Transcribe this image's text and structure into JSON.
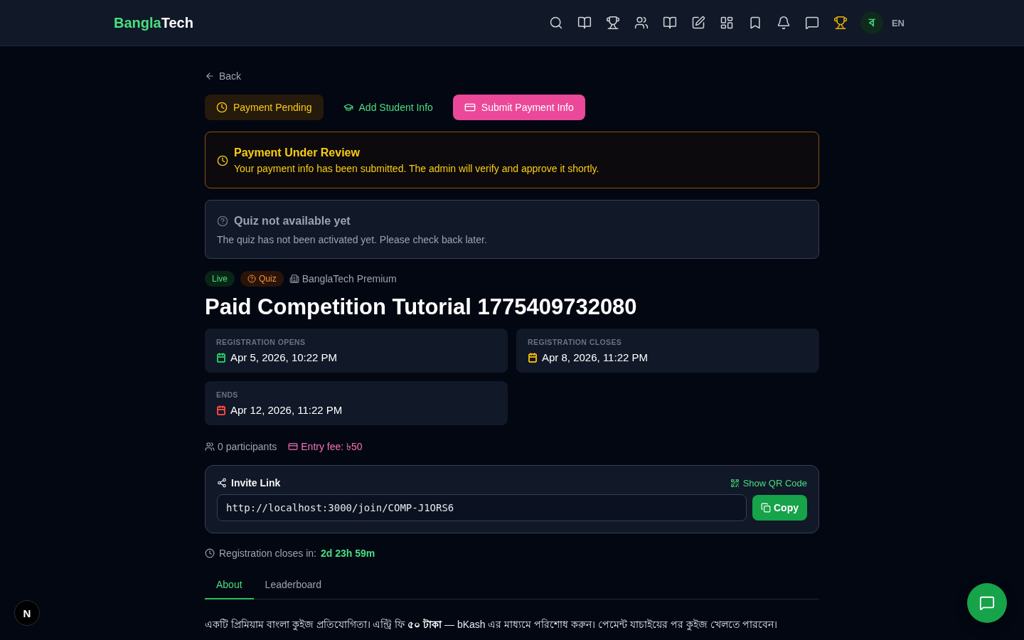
{
  "header": {
    "logo": {
      "part_1": "Bangla",
      "part_2": "Tech"
    },
    "avatar_initial": "ব",
    "language": "EN"
  },
  "back_link": "Back",
  "actions": [
    {
      "kind": "status",
      "label": "Payment Pending"
    },
    {
      "kind": "link",
      "label": "Add Student Info"
    },
    {
      "kind": "primary",
      "label": "Submit Payment Info"
    }
  ],
  "payment_alert": {
    "title": "Payment Under Review",
    "message": "Your payment info has been submitted. The admin will verify and approve it shortly."
  },
  "quiz_notice": {
    "title": "Quiz not available yet",
    "message": "The quiz has not been activated yet. Please check back later."
  },
  "badges": [
    {
      "kind": "status",
      "label": "Live"
    },
    {
      "kind": "type",
      "label": "Quiz"
    }
  ],
  "organizer": "BanglaTech Premium",
  "title": "Paid Competition Tutorial 1775409732080",
  "dates": [
    {
      "label": "REGISTRATION OPENS",
      "value": "Apr 5, 2026, 10:22 PM",
      "color": "#22c55e"
    },
    {
      "label": "REGISTRATION CLOSES",
      "value": "Apr 8, 2026, 11:22 PM",
      "color": "#eab308"
    },
    {
      "label": "ENDS",
      "value": "Apr 12, 2026, 11:22 PM",
      "color": "#ef4444"
    }
  ],
  "stats": {
    "participants": "0 participants",
    "entry_fee": "Entry fee: ৳50"
  },
  "invite": {
    "title": "Invite Link",
    "qr_link": "Show QR Code",
    "url": "http://localhost:3000/join/COMP-J1ORS6",
    "copy_button": "Copy"
  },
  "countdown": {
    "label": "Registration closes in:",
    "value": "2d 23h 59m"
  },
  "tabs": [
    {
      "label": "About",
      "selected": true
    },
    {
      "label": "Leaderboard",
      "selected": false
    }
  ],
  "about_text": "একটি প্রিমিয়াম বাংলা কুইজ প্রতিযোগিতা। এন্ট্রি ফি **৫০ টাকা** — bKash এর মাধ্যমে পরিশোধ করুন। পেমেন্ট যাচাইয়ের পর কুইজ খেলতে পারবেন।",
  "dev_badge": "N"
}
